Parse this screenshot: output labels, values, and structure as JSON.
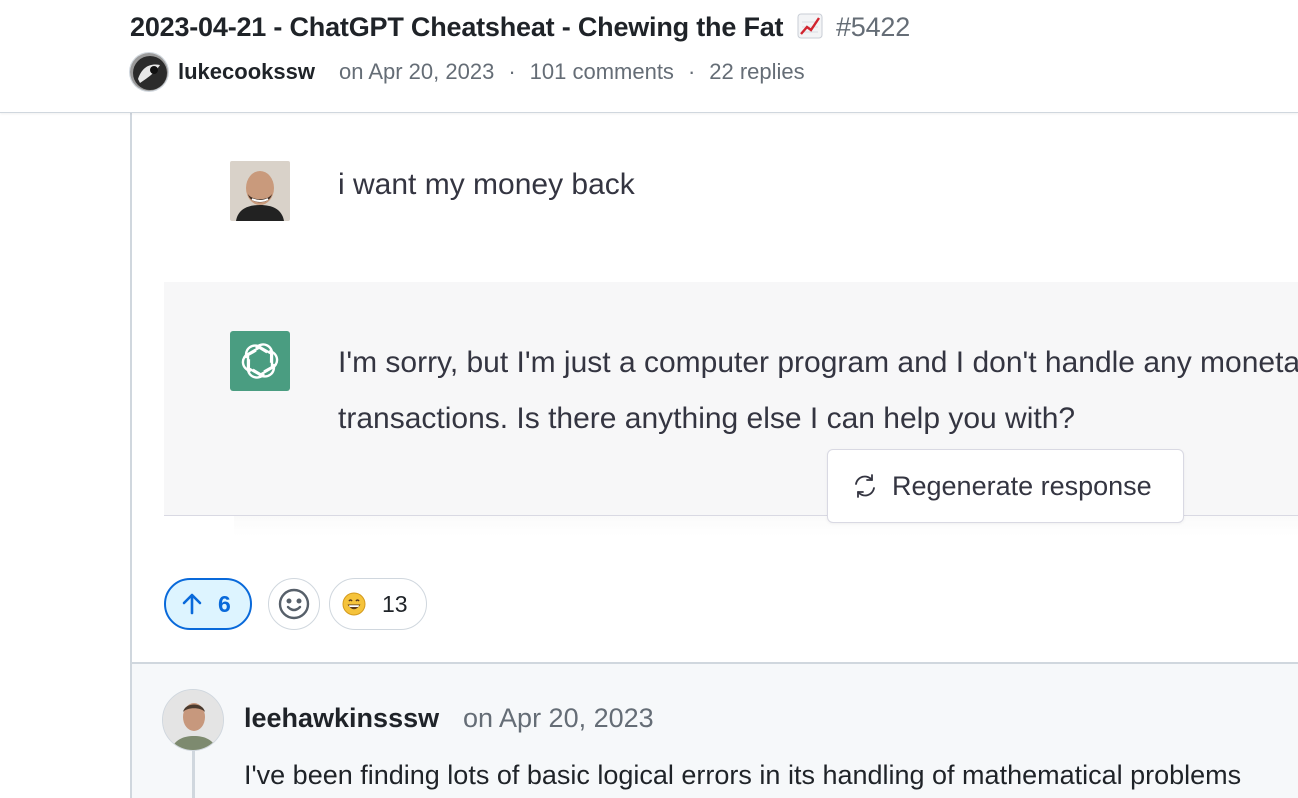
{
  "discussion": {
    "title": "2023-04-21 - ChatGPT Cheatsheat - Chewing the Fat",
    "title_icon": "chart-increasing-emoji",
    "number": "#5422",
    "author": "lukecookssw",
    "date": "on Apr 20, 2023",
    "separator": "·",
    "comments": "101 comments",
    "replies": "22 replies"
  },
  "chat_screenshot": {
    "user_message": "i want my money back",
    "assistant_message": "I'm sorry, but I'm just a computer program and I don't handle any monetary transactions. Is there anything else I can help you with?",
    "regenerate_label": "Regenerate response",
    "assistant_color": "#4a9d81"
  },
  "reactions": {
    "upvotes": "6",
    "laugh_count": "13",
    "upvote_color": "#0969da"
  },
  "reply": {
    "author": "leehawkinsssw",
    "date": "on Apr 20, 2023",
    "body": "I've been finding lots of basic logical errors in its handling of mathematical problems"
  }
}
